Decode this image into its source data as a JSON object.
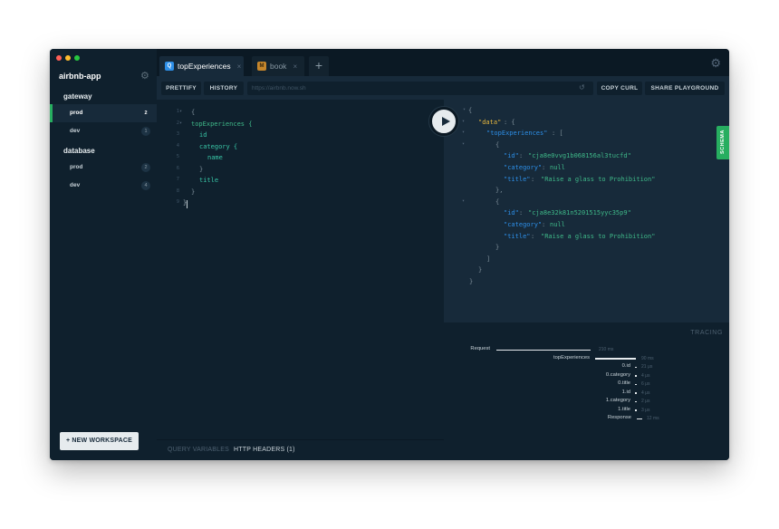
{
  "sidebar": {
    "app_name": "airbnb-app",
    "groups": [
      {
        "label": "gateway",
        "items": [
          {
            "name": "prod",
            "count": "2"
          },
          {
            "name": "dev",
            "count": "1"
          }
        ]
      },
      {
        "label": "database",
        "items": [
          {
            "name": "prod",
            "count": "2"
          },
          {
            "name": "dev",
            "count": "4"
          }
        ]
      }
    ],
    "new_workspace_label": "+ NEW WORKSPACE"
  },
  "tabs": [
    {
      "badge": "Q",
      "label": "topExperiences",
      "close": "×"
    },
    {
      "badge": "M",
      "label": "book",
      "close": "×"
    }
  ],
  "tab_add": "+",
  "icons": {
    "gear": "⚙",
    "reload": "↺"
  },
  "toolbar": {
    "prettify": "PRETTIFY",
    "history": "HISTORY",
    "url": "https://airbnb.now.sh",
    "copy_curl": "COPY CURL",
    "share": "SHARE PLAYGROUND"
  },
  "query": {
    "lines": [
      {
        "n": "1",
        "text": "{"
      },
      {
        "n": "2",
        "text": "topExperiences {"
      },
      {
        "n": "3",
        "text": "id"
      },
      {
        "n": "4",
        "text": "category {"
      },
      {
        "n": "5",
        "text": "name"
      },
      {
        "n": "6",
        "text": "}"
      },
      {
        "n": "7",
        "text": "title"
      },
      {
        "n": "8",
        "text": "}"
      },
      {
        "n": "9",
        "text": "}"
      }
    ]
  },
  "bottom_bar": {
    "variables": "QUERY VARIABLES",
    "headers": "HTTP HEADERS (1)"
  },
  "result": {
    "key_data": "\"data\"",
    "key_top": "\"topExperiences\"",
    "key_id": "\"id\"",
    "key_category": "\"category\"",
    "key_title": "\"title\"",
    "null": "null",
    "items": [
      {
        "id": "\"cja8e0vvg1b068156al3tucfd\"",
        "title": "\"Raise a glass to Prohibition\""
      },
      {
        "id": "\"cja8e32k81n5201515yyc35p9\"",
        "title": "\"Raise a glass to Prohibition\""
      }
    ]
  },
  "schema_label": "SCHEMA",
  "tracing": {
    "title": "TRACING",
    "rows": [
      {
        "label": "Request",
        "duration": "210 ms"
      },
      {
        "label": "topExperiences",
        "duration": "90 ms"
      },
      {
        "label": "0.id",
        "duration": "21 μs"
      },
      {
        "label": "0.category",
        "duration": "4 μs"
      },
      {
        "label": "0.title",
        "duration": "6 μs"
      },
      {
        "label": "1.id",
        "duration": "4 μs"
      },
      {
        "label": "1.category",
        "duration": "2 μs"
      },
      {
        "label": "1.title",
        "duration": "3 μs"
      },
      {
        "label": "Response",
        "duration": "12 ms"
      }
    ]
  }
}
